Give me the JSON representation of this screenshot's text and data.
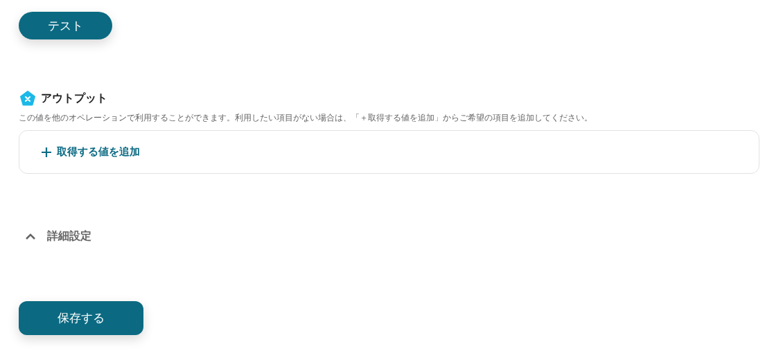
{
  "test_button": {
    "label": "テスト"
  },
  "output": {
    "title": "アウトプット",
    "description": "この値を他のオペレーションで利用することができます。利用したい項目がない場合は、「＋取得する値を追加」からご希望の項目を追加してください。",
    "add_button": {
      "label": "取得する値を追加"
    }
  },
  "advanced_settings": {
    "label": "詳細設定",
    "expanded": true
  },
  "save_button": {
    "label": "保存する"
  }
}
